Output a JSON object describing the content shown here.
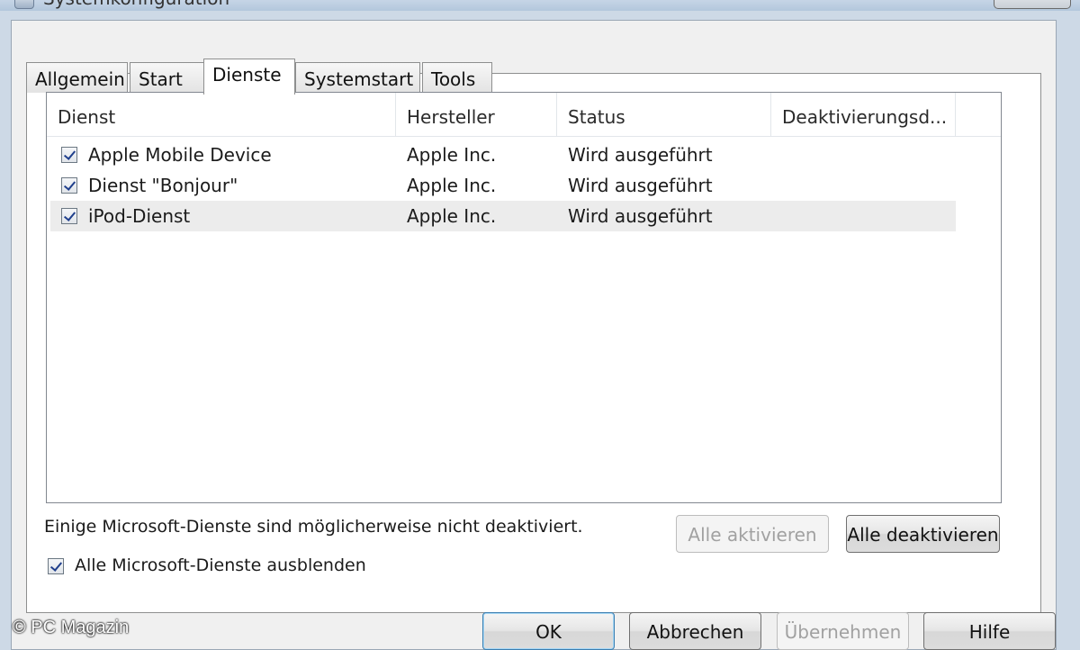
{
  "window": {
    "title": "Systemkonfiguration"
  },
  "tabs": [
    {
      "label": "Allgemein"
    },
    {
      "label": "Start"
    },
    {
      "label": "Dienste",
      "active": true
    },
    {
      "label": "Systemstart"
    },
    {
      "label": "Tools"
    }
  ],
  "services_table": {
    "columns": [
      "Dienst",
      "Hersteller",
      "Status",
      "Deaktivierungsd..."
    ],
    "rows": [
      {
        "checked": true,
        "dienst": "Apple Mobile Device",
        "hersteller": "Apple Inc.",
        "status": "Wird ausgeführt",
        "deaktivierungsdatum": ""
      },
      {
        "checked": true,
        "dienst": "Dienst \"Bonjour\"",
        "hersteller": "Apple Inc.",
        "status": "Wird ausgeführt",
        "deaktivierungsdatum": ""
      },
      {
        "checked": true,
        "dienst": "iPod-Dienst",
        "hersteller": "Apple Inc.",
        "status": "Wird ausgeführt",
        "deaktivierungsdatum": ""
      }
    ]
  },
  "note": "Einige Microsoft-Dienste sind möglicherweise nicht deaktiviert.",
  "buttons": {
    "enable_all": "Alle aktivieren",
    "disable_all": "Alle deaktivieren",
    "ok": "OK",
    "cancel": "Abbrechen",
    "apply": "Übernehmen",
    "help": "Hilfe"
  },
  "hide_ms_services": {
    "label": "Alle Microsoft-Dienste ausblenden",
    "checked": true
  },
  "watermark": "© PC Magazin",
  "colors": {
    "dialog_bg": "#f0f0f0",
    "selected_row": "#ececec",
    "check_mark": "#1f3f8c"
  }
}
